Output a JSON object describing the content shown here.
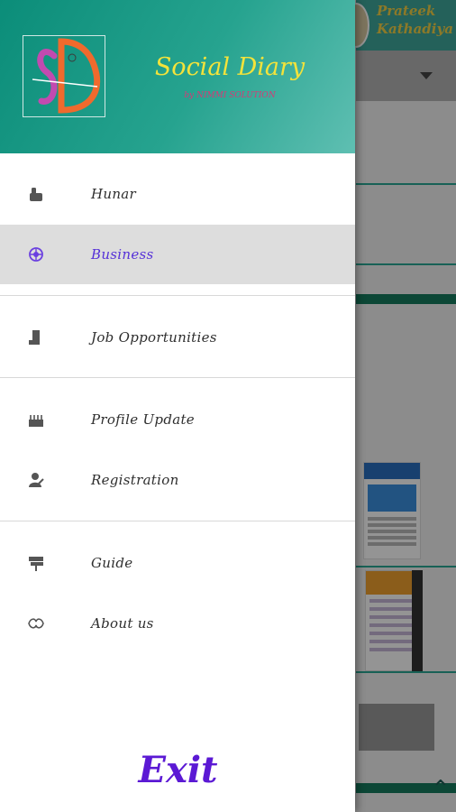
{
  "background": {
    "user_name": "Prateek Kathadiya"
  },
  "header": {
    "app_title": "Social Diary",
    "app_subtitle": "by NIMMI SOLUTION",
    "logo_text": "SD"
  },
  "menu": {
    "items": [
      {
        "label": "Hunar",
        "icon": "hunar-icon"
      },
      {
        "label": "Business",
        "icon": "business-icon",
        "active": true
      },
      {
        "label": "Job Opportunities",
        "icon": "job-icon"
      },
      {
        "label": "Profile Update",
        "icon": "profile-update-icon"
      },
      {
        "label": "Registration",
        "icon": "registration-icon"
      },
      {
        "label": "Guide",
        "icon": "guide-icon"
      },
      {
        "label": "About us",
        "icon": "about-icon"
      }
    ]
  },
  "footer": {
    "exit_label": "Exit"
  },
  "colors": {
    "header_start": "#0b8d79",
    "header_end": "#5fbfb2",
    "title": "#f4e33a",
    "subtitle": "#d63a76",
    "active_label": "#5530d8",
    "exit": "#5b19d4",
    "active_bg": "#dddddd"
  }
}
